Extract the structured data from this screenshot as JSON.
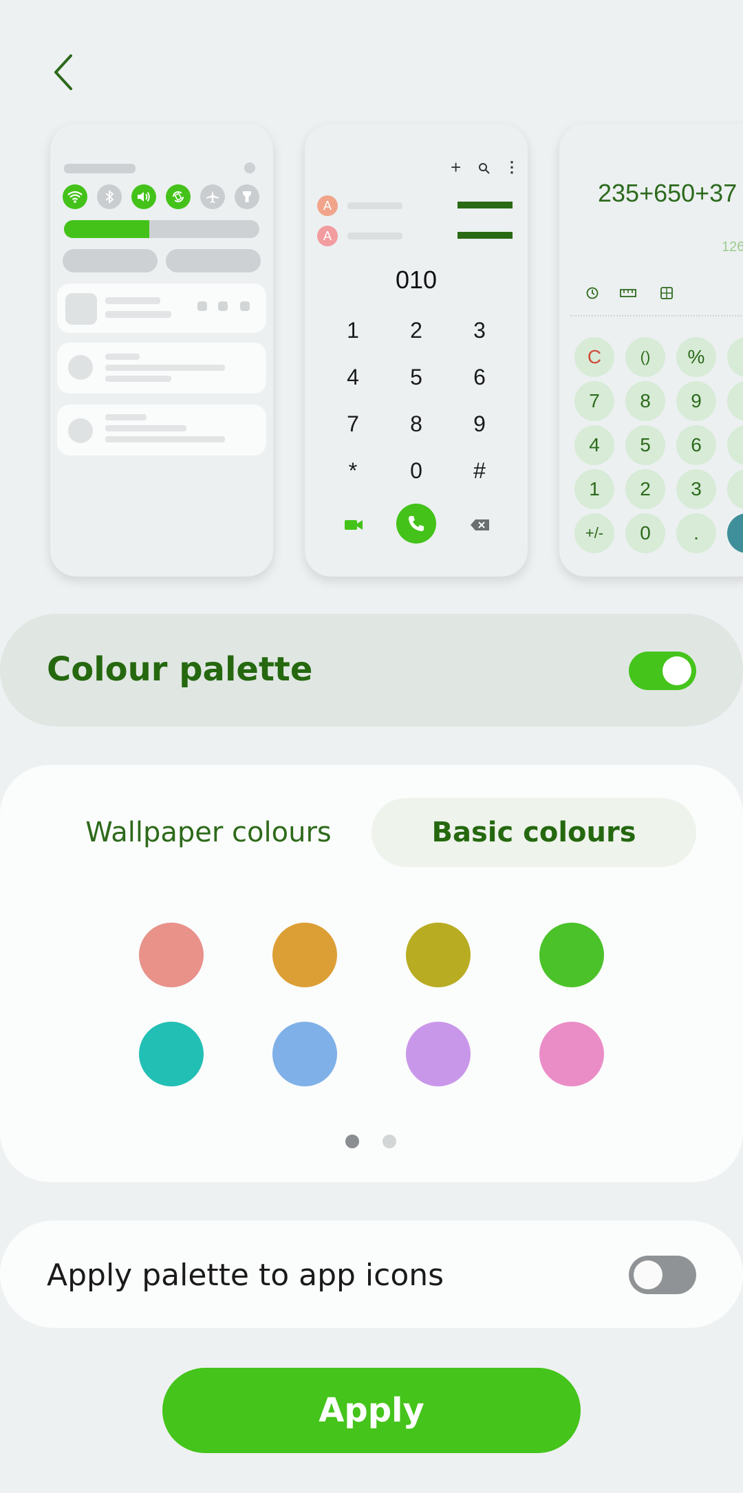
{
  "header": {
    "back_icon": "chevron-left-icon"
  },
  "previews": {
    "dialer": {
      "number": "010",
      "keys": [
        "1",
        "2",
        "3",
        "4",
        "5",
        "6",
        "7",
        "8",
        "9",
        "*",
        "0",
        "#"
      ],
      "contact_initial": "A"
    },
    "calculator": {
      "expression": "235+650+37",
      "result": "126",
      "keys": [
        "C",
        "()",
        "%",
        "7",
        "8",
        "9",
        "4",
        "5",
        "6",
        "1",
        "2",
        "3",
        "+/-",
        "0",
        "."
      ]
    }
  },
  "palette": {
    "title": "Colour palette",
    "enabled": true,
    "accent": "#45c41b"
  },
  "tabs": {
    "wallpaper": "Wallpaper colours",
    "basic": "Basic colours",
    "selected": "basic"
  },
  "swatches": [
    "#e8928a",
    "#dc9f35",
    "#b8ac22",
    "#4bc22a",
    "#22bfb4",
    "#7fb0e8",
    "#c997ea",
    "#ea8dc7"
  ],
  "pager": {
    "pages": 2,
    "current": 1
  },
  "icons_row": {
    "label": "Apply palette to app icons",
    "enabled": false
  },
  "apply_button": {
    "label": "Apply"
  }
}
